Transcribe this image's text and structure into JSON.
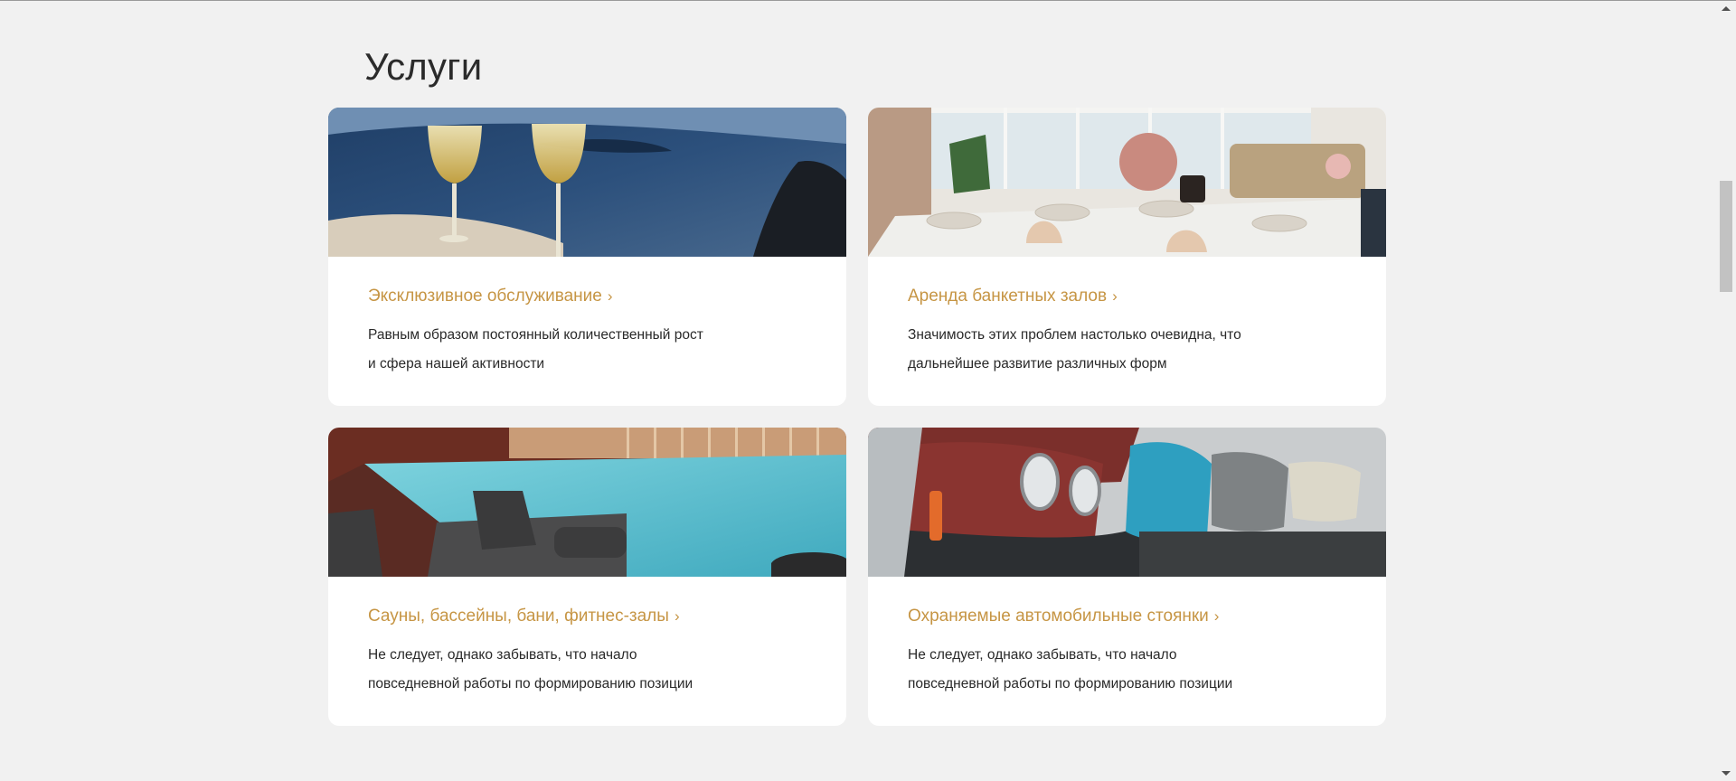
{
  "page": {
    "title": "Услуги"
  },
  "services": [
    {
      "title": "Эксклюзивное обслуживание",
      "chevron": "›",
      "text_lines": [
        "Равным образом постоянный количественный рост",
        "и сфера нашей активности"
      ],
      "image": "champagne-glasses-sea-photo"
    },
    {
      "title": "Аренда банкетных залов",
      "chevron": "›",
      "text_lines": [
        "Значимость этих проблем настолько очевидна, что",
        "дальнейшее развитие различных форм"
      ],
      "image": "banquet-dining-room-photo"
    },
    {
      "title": "Сауны, бассейны, бани, фитнес-залы",
      "chevron": "›",
      "text_lines": [
        "Не следует, однако забывать, что начало",
        "повседневной работы по формированию позиции"
      ],
      "image": "indoor-pool-photo"
    },
    {
      "title": "Охраняемые автомобильные стоянки",
      "chevron": "›",
      "text_lines": [
        "Не следует, однако забывать, что начало",
        "повседневной работы по формированию позиции"
      ],
      "image": "classic-cars-parking-photo"
    }
  ],
  "colors": {
    "accent": "#c69544",
    "background": "#f1f1f1",
    "card": "#ffffff",
    "text": "#2a2a2a"
  }
}
